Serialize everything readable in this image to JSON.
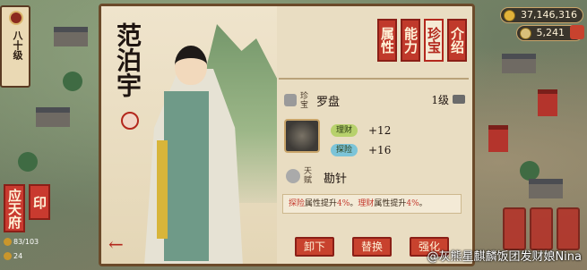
{
  "rank": {
    "label": "八十级"
  },
  "location": {
    "label": "应天府",
    "seal": "印"
  },
  "left_stats": {
    "troops": "83/103",
    "coins": "24"
  },
  "character": {
    "name": "范泊宇"
  },
  "tabs": [
    {
      "label": "属性",
      "active": false
    },
    {
      "label": "能力",
      "active": false
    },
    {
      "label": "珍宝",
      "active": true
    },
    {
      "label": "介绍",
      "active": false
    }
  ],
  "treasure": {
    "slot_label": "珍宝",
    "name": "罗盘",
    "level": "1级",
    "attrs": [
      {
        "label": "理财",
        "value": "+12",
        "color": "#b7d16c"
      },
      {
        "label": "探险",
        "value": "+16",
        "color": "#7cc4d8"
      }
    ]
  },
  "talent": {
    "slot_label": "天赋",
    "name": "勘针",
    "desc_part1": "探险",
    "desc_part2": "属性提升",
    "desc_pct1": "4%",
    "desc_part3": "。",
    "desc_part4": "理财",
    "desc_part5": "属性提升",
    "desc_pct2": "4%",
    "desc_part6": "。"
  },
  "actions": {
    "unequip": "卸下",
    "replace": "替换",
    "upgrade": "强化"
  },
  "currency": {
    "silver": "37,146,316",
    "gold": "5,241"
  },
  "watermark": "@灰熊星麒麟饭团发财娘Nina",
  "colors": {
    "accent_red": "#c0392b",
    "parchment": "#e9ddc2"
  }
}
